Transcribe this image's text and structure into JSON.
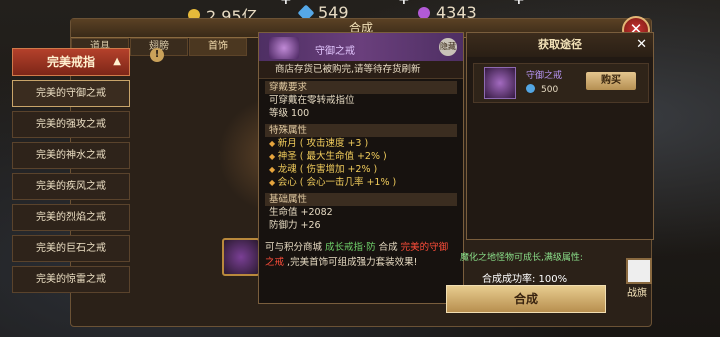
{
  "currency": {
    "gold": "2.95亿",
    "diamond": "549",
    "gem": "4343"
  },
  "window": {
    "title": "合成"
  },
  "tabs": [
    "道具",
    "翅膀",
    "首饰"
  ],
  "sidebar": {
    "header": "完美戒指",
    "items": [
      "完美的守御之戒",
      "完美的强攻之戒",
      "完美的神水之戒",
      "完美的疾风之戒",
      "完美的烈焰之戒",
      "完美的巨石之戒",
      "完美的惊雷之戒"
    ]
  },
  "tooltip": {
    "name": "守御之戒",
    "button_label": "隐藏",
    "subtitle": "商店存货已被购完,请等待存货刷新",
    "wear_title": "穿戴要求",
    "wear_lines": [
      "可穿戴在零转戒指位",
      "等级 100"
    ],
    "special_title": "特殊属性",
    "special_lines": [
      "新月 ( 攻击速度 +3 )",
      "神圣 ( 最大生命值 +2% )",
      "龙魂 ( 伤害增加 +2% )",
      "会心 ( 会心一击几率 +1% )"
    ],
    "base_title": "基础属性",
    "base_lines": [
      "生命值 +2082",
      "防御力 +26"
    ],
    "desc_a": "可与积分商城",
    "desc_b": "成长戒指·防",
    "desc_c": "合成",
    "desc_d": "完美的守御之戒",
    "desc_e": ",完美首饰可组成强力套装效果!"
  },
  "get_panel": {
    "title": "获取途径",
    "item_name": "守御之戒",
    "price": "500",
    "buy_label": "购买"
  },
  "bottom_info": "魔化之地怪物可成长,满级属性:",
  "rate_label": "合成成功率: 100%",
  "compose_label": "合成",
  "flag_label": "战旗"
}
